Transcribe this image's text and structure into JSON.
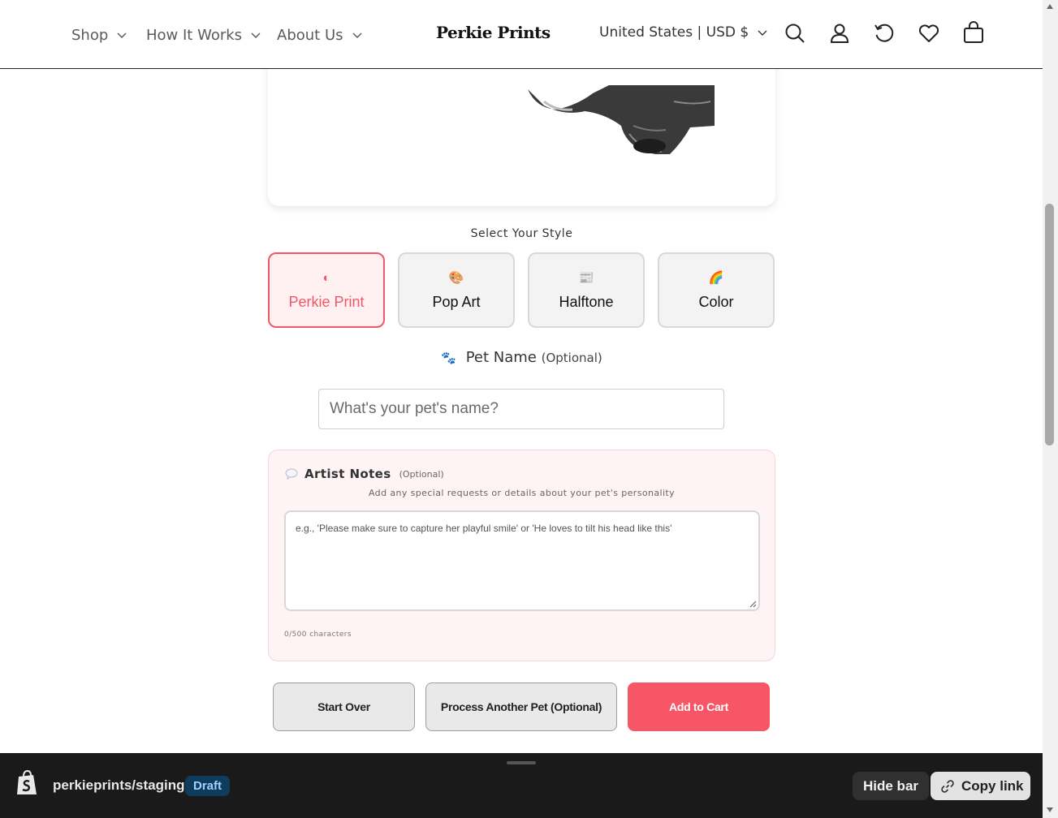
{
  "header": {
    "nav": [
      {
        "label": "Shop"
      },
      {
        "label": "How It Works"
      },
      {
        "label": "About Us"
      }
    ],
    "logo": "Perkie Prints",
    "currency": "United States | USD $",
    "icons": [
      "search-icon",
      "account-icon",
      "history-icon",
      "wishlist-heart-icon",
      "cart-icon"
    ]
  },
  "style_selector": {
    "title": "Select Your Style",
    "options": [
      {
        "label": "Perkie Print",
        "icon": "◐",
        "active": true
      },
      {
        "label": "Pop Art",
        "icon": "🎨",
        "active": false
      },
      {
        "label": "Halftone",
        "icon": "📰",
        "active": false
      },
      {
        "label": "Color",
        "icon": "🌈",
        "active": false
      }
    ],
    "accent_color": "#f0586a"
  },
  "pet_name": {
    "icon": "🐾",
    "label": "Pet Name",
    "optional": "(Optional)",
    "placeholder": "What's your pet's name?",
    "value": ""
  },
  "artist_notes": {
    "title": "Artist Notes",
    "optional": "(Optional)",
    "subtitle": "Add any special requests or details about your pet's personality",
    "placeholder": "e.g., 'Please make sure to capture her playful smile' or 'He loves to tilt his head like this'",
    "value": "",
    "char_count": "0/500 characters"
  },
  "actions": {
    "start_over": "Start Over",
    "process_another": "Process Another Pet (Optional)",
    "add_to_cart": "Add to Cart",
    "add_to_cart_color": "#f65665"
  },
  "preview_bar": {
    "store": "perkieprints/staging",
    "badge": "Draft",
    "hide_bar": "Hide bar",
    "copy_link": "Copy link"
  }
}
